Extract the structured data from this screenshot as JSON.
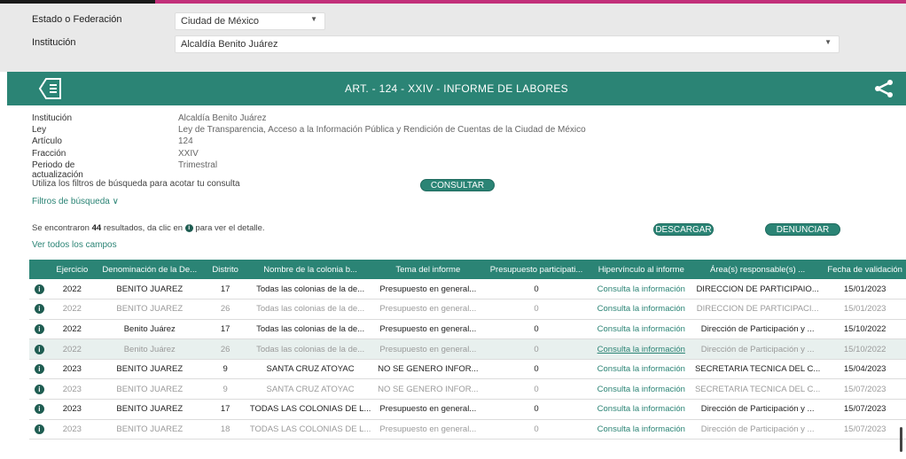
{
  "filters": {
    "estado_label": "Estado o Federación",
    "estado_value": "Ciudad de México",
    "institucion_label": "Institución",
    "institucion_value": "Alcaldía Benito Juárez"
  },
  "banner": {
    "title": "ART. - 124 - XXIV - INFORME DE LABORES"
  },
  "info": [
    {
      "k": "Institución",
      "v": "Alcaldía Benito Juárez"
    },
    {
      "k": "Ley",
      "v": "Ley de Transparencia, Acceso a la Información Pública y Rendición de Cuentas de la Ciudad de México"
    },
    {
      "k": "Artículo",
      "v": "124"
    },
    {
      "k": "Fracción",
      "v": "XXIV"
    },
    {
      "k": "Periodo de actualización",
      "v": "Trimestral"
    }
  ],
  "search": {
    "hint": "Utiliza los filtros de búsqueda para acotar tu consulta",
    "consultar": "CONSULTAR",
    "filtros": "Filtros de búsqueda"
  },
  "results": {
    "prefix": "Se encontraron",
    "count": "44",
    "middle": "resultados, da clic en",
    "suffix": "para ver el detalle.",
    "descargar": "DESCARGAR",
    "denunciar": "DENUNCIAR",
    "ver_todos": "Ver todos los campos"
  },
  "table": {
    "headers": [
      "Ejercicio",
      "Denominación de la De...",
      "Distrito",
      "Nombre de la colonia b...",
      "Tema del informe",
      "Presupuesto participati...",
      "Hipervínculo al informe",
      "Área(s) responsable(s) ...",
      "Fecha de validación"
    ],
    "rows": [
      [
        "2022",
        "BENITO JUAREZ",
        "17",
        "Todas las colonias de la de...",
        "Presupuesto en general...",
        "0",
        "Consulta la información",
        "DIRECCION DE PARTICIPAIO...",
        "15/01/2023"
      ],
      [
        "2022",
        "BENITO JUAREZ",
        "26",
        "Todas las colonias de la de...",
        "Presupuesto en general...",
        "0",
        "Consulta la información",
        "DIRECCION DE PARTICIPACI...",
        "15/01/2023"
      ],
      [
        "2022",
        "Benito Juárez",
        "17",
        "Todas las colonias de la de...",
        "Presupuesto en general...",
        "0",
        "Consulta la información",
        "Dirección de Participación y ...",
        "15/10/2022"
      ],
      [
        "2022",
        "Benito Juárez",
        "26",
        "Todas las colonias de la de...",
        "Presupuesto en general...",
        "0",
        "Consulta la información",
        "Dirección de Participación y ...",
        "15/10/2022"
      ],
      [
        "2023",
        "BENITO JUAREZ",
        "9",
        "SANTA CRUZ ATOYAC",
        "NO SE GENERO INFOR...",
        "0",
        "Consulta la información",
        "SECRETARIA TECNICA DEL C...",
        "15/04/2023"
      ],
      [
        "2023",
        "BENITO JUAREZ",
        "9",
        "SANTA CRUZ ATOYAC",
        "NO SE GENERO INFOR...",
        "0",
        "Consulta la información",
        "SECRETARIA TECNICA DEL C...",
        "15/07/2023"
      ],
      [
        "2023",
        "BENITO JUAREZ",
        "17",
        "TODAS LAS COLONIAS DE L...",
        "Presupuesto en general...",
        "0",
        "Consulta la información",
        "Dirección de Participación y ...",
        "15/07/2023"
      ],
      [
        "2023",
        "BENITO JUAREZ",
        "18",
        "TODAS LAS COLONIAS DE L...",
        "Presupuesto en general...",
        "0",
        "Consulta la información",
        "Dirección de Participación y ...",
        "15/07/2023"
      ]
    ]
  },
  "colors": {
    "accent": "#2b8475",
    "brand_pink": "#c2307a"
  },
  "icons": [
    "tag-icon",
    "share-icon",
    "info-icon",
    "chevron-down-icon"
  ]
}
